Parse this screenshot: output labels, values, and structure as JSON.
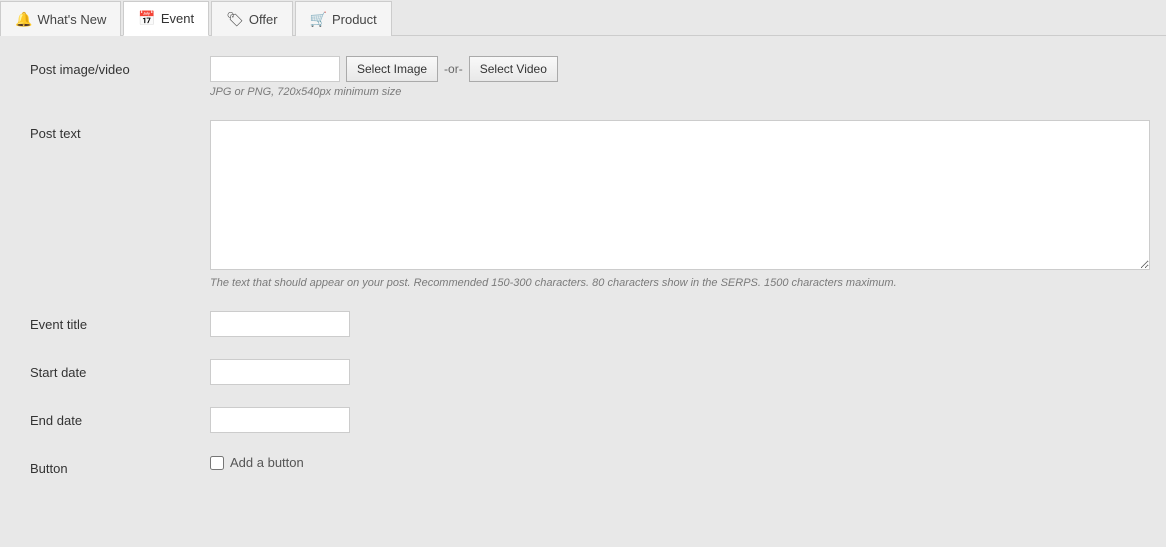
{
  "tabs": [
    {
      "id": "whats-new",
      "label": "What's New",
      "icon": "🔔",
      "active": false
    },
    {
      "id": "event",
      "label": "Event",
      "icon": "📅",
      "active": true
    },
    {
      "id": "offer",
      "label": "Offer",
      "icon": "🏷",
      "active": false
    },
    {
      "id": "product",
      "label": "Product",
      "icon": "🛒",
      "active": false
    }
  ],
  "form": {
    "post_image_video": {
      "label": "Post image/video",
      "image_url_placeholder": "",
      "select_image_label": "Select Image",
      "or_text": "-or-",
      "select_video_label": "Select Video",
      "hint": "JPG or PNG, 720x540px minimum size"
    },
    "post_text": {
      "label": "Post text",
      "placeholder": "",
      "hint": "The text that should appear on your post. Recommended 150-300 characters. 80 characters show in the SERPS. 1500 characters maximum."
    },
    "event_title": {
      "label": "Event title",
      "placeholder": ""
    },
    "start_date": {
      "label": "Start date",
      "placeholder": ""
    },
    "end_date": {
      "label": "End date",
      "placeholder": ""
    },
    "button": {
      "label": "Button",
      "checkbox_label": "Add a button",
      "checked": false
    }
  }
}
